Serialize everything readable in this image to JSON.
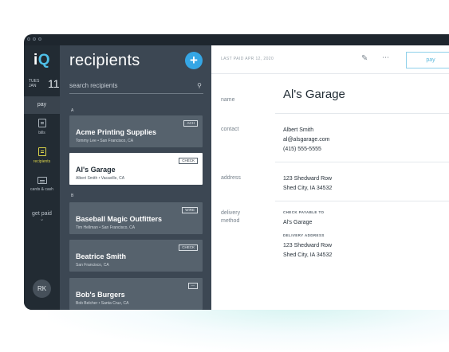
{
  "rail": {
    "logo_main": "i",
    "logo_accent": "Q",
    "date": {
      "dow": "TUES",
      "month": "JAN",
      "day": "11"
    },
    "pay_label": "pay",
    "nav": [
      {
        "label": "bills",
        "icon": "bills-icon"
      },
      {
        "label": "recipients",
        "icon": "recipients-icon"
      },
      {
        "label": "cards & cash",
        "icon": "cards-icon"
      }
    ],
    "get_paid_label": "get paid",
    "avatar_initials": "RK",
    "accent_color": "#d9d24a"
  },
  "list": {
    "title": "recipients",
    "search_placeholder": "search recipients",
    "sections": [
      {
        "letter": "A",
        "items": [
          {
            "name": "Acme Printing Supplies",
            "meta": "Tommy Lee • San Francisco, CA",
            "badge": "ACH",
            "selected": false
          },
          {
            "name": "Al's Garage",
            "meta": "Albert Smith • Vacaville, CA",
            "badge": "CHECK",
            "selected": true
          }
        ]
      },
      {
        "letter": "B",
        "items": [
          {
            "name": "Baseball Magic Outfitters",
            "meta": "Tim Hellman • San Francisco, CA",
            "badge": "WIRE",
            "selected": false
          },
          {
            "name": "Beatrice Smith",
            "meta": "San Francisco, CA",
            "badge": "CHECK",
            "selected": false
          },
          {
            "name": "Bob's Burgers",
            "meta": "Bob Belcher • Santa Cruz, CA",
            "badge": "—",
            "selected": false
          }
        ]
      }
    ]
  },
  "detail": {
    "last_paid": "LAST PAID APR 12, 2020",
    "pay_button": "pay",
    "name_label": "name",
    "name_value": "Al's Garage",
    "contact_label": "contact",
    "contact_lines": [
      "Albert Smith",
      "al@alsgarage.com",
      "(415) 555-5555"
    ],
    "address_label": "address",
    "address_lines": [
      "123 Shedward Row",
      "Shed City, IA 34532"
    ],
    "delivery_label_1": "delivery",
    "delivery_label_2": "method",
    "check_payable_head": "CHECK PAYABLE TO",
    "check_payable_value": "Al's Garage",
    "delivery_address_head": "DELIVERY ADDRESS",
    "delivery_address_lines": [
      "123 Shedward Row",
      "Shed City, IA 34532"
    ]
  }
}
